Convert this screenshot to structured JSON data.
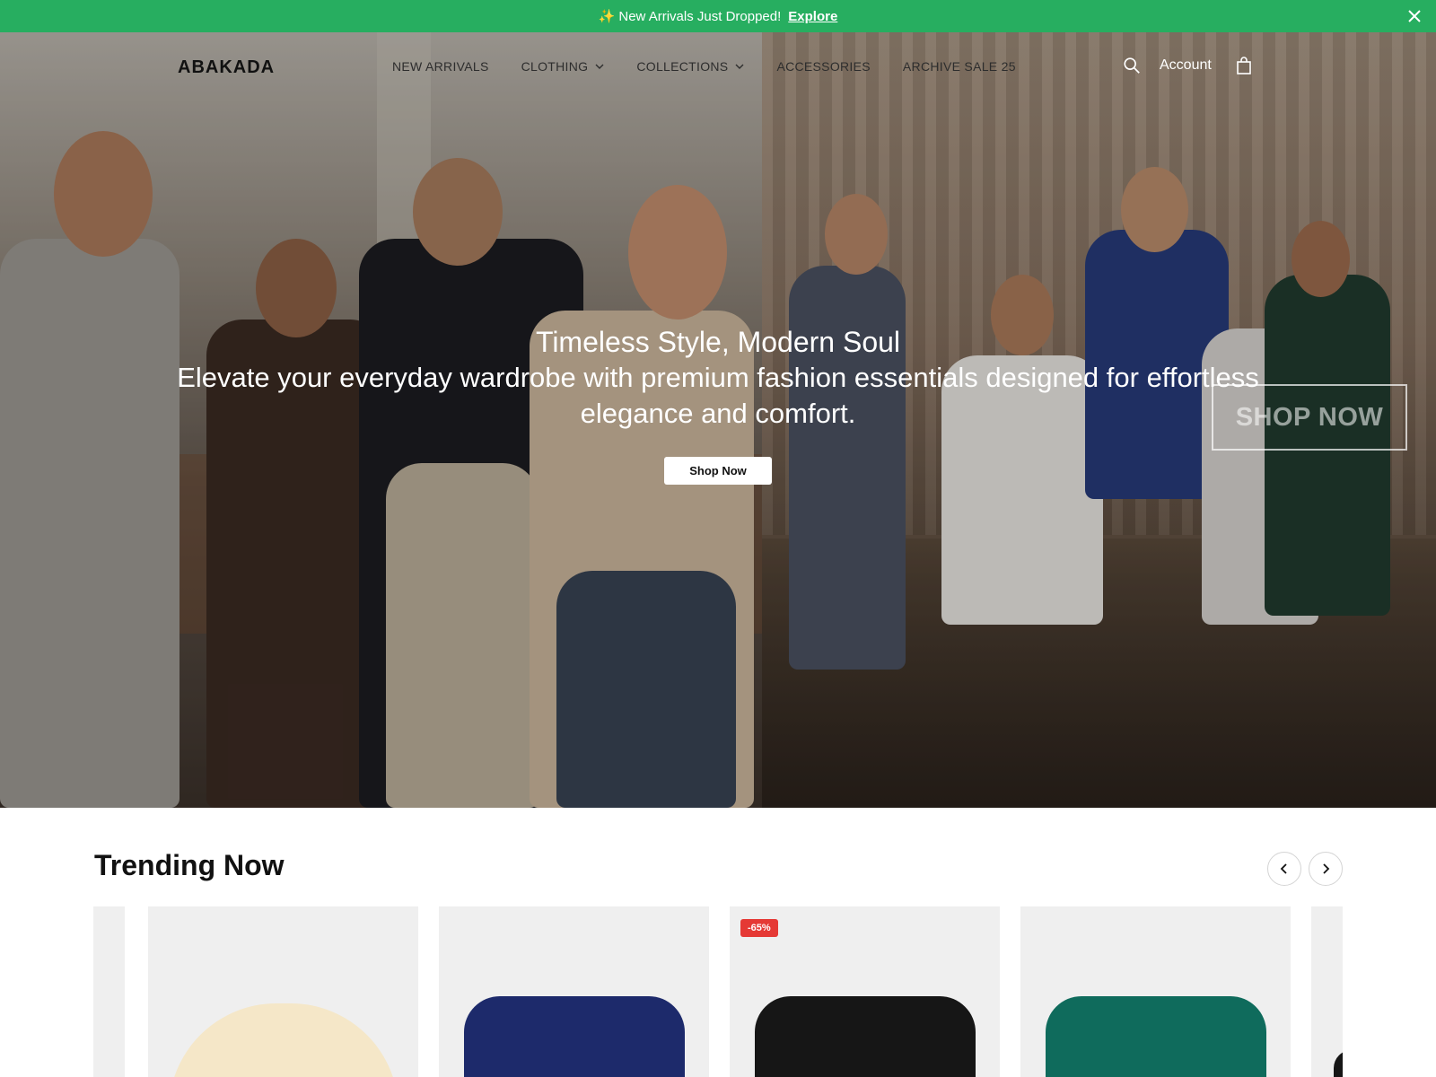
{
  "announcement": {
    "sparkle": "✨",
    "text": "New Arrivals Just Dropped!",
    "link": "Explore"
  },
  "header": {
    "logo": "ABAKADA",
    "nav": [
      {
        "label": "NEW ARRIVALS",
        "has_dropdown": false
      },
      {
        "label": "CLOTHING",
        "has_dropdown": true
      },
      {
        "label": "COLLECTIONS",
        "has_dropdown": true
      },
      {
        "label": "ACCESSORIES",
        "has_dropdown": false
      },
      {
        "label": "ARCHIVE SALE 25",
        "has_dropdown": false
      }
    ],
    "account": "Account",
    "icons": [
      "search-icon",
      "shopping-bag-icon"
    ]
  },
  "hero": {
    "title": "Timeless Style, Modern Soul",
    "subtitle": "Elevate your everyday wardrobe with premium fashion essentials designed for effortless elegance and comfort.",
    "cta": "Shop Now",
    "cta_outline": "SHOP NOW"
  },
  "trending": {
    "title": "Trending Now",
    "products": [
      {
        "color": "#f5e7c8",
        "badge": ""
      },
      {
        "color": "#1d2a6b",
        "badge": ""
      },
      {
        "color": "#161616",
        "badge": "-65%"
      },
      {
        "color": "#0f6b5c",
        "badge": ""
      }
    ]
  },
  "colors": {
    "announcement_bg": "#27ae60",
    "sale_badge": "#e53935"
  }
}
